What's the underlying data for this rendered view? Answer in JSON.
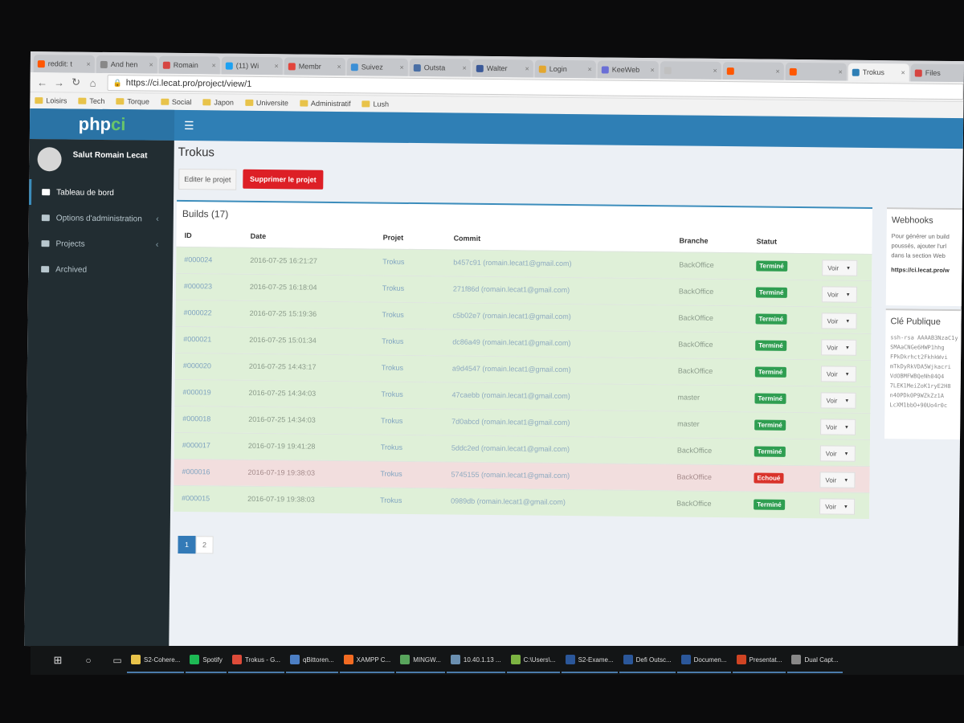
{
  "browser": {
    "tabs": [
      {
        "label": "reddit: t",
        "color": "#ff5700"
      },
      {
        "label": "And hen",
        "color": "#888888"
      },
      {
        "label": "Romain",
        "color": "#d64541"
      },
      {
        "label": "(11) Wi",
        "color": "#1da1f2"
      },
      {
        "label": "Membr",
        "color": "#e2453c"
      },
      {
        "label": "Suivez",
        "color": "#3b8fd6"
      },
      {
        "label": "Outsta",
        "color": "#4a6fa5"
      },
      {
        "label": "Walter",
        "color": "#3b5998"
      },
      {
        "label": "Login",
        "color": "#e3a72f"
      },
      {
        "label": "KeeWeb",
        "color": "#6a6fd6"
      },
      {
        "label": "",
        "color": "#c0c0c0"
      },
      {
        "label": "",
        "color": "#ff5700"
      },
      {
        "label": "",
        "color": "#ff5700"
      },
      {
        "label": "Trokus",
        "color": "#2f7fb5",
        "active": true
      },
      {
        "label": "Files",
        "color": "#d64541"
      }
    ],
    "url": "https://ci.lecat.pro/project/view/1",
    "bookmarks": [
      "Loisirs",
      "Tech",
      "Torque",
      "Social",
      "Japon",
      "Universite",
      "Administratif",
      "Lush"
    ]
  },
  "app": {
    "logo_main": "php",
    "logo_accent": "ci",
    "user_greeting": "Salut Romain Lecat",
    "sidebar": [
      {
        "label": "Tableau de bord",
        "active": true,
        "chevron": false
      },
      {
        "label": "Options d'administration",
        "active": false,
        "chevron": true
      },
      {
        "label": "Projects",
        "active": false,
        "chevron": true
      },
      {
        "label": "Archived",
        "active": false,
        "chevron": false
      }
    ],
    "page_title": "Trokus",
    "edit_button": "Editer le projet",
    "delete_button": "Supprimer le projet",
    "builds_title": "Builds (17)",
    "columns": {
      "id": "ID",
      "date": "Date",
      "project": "Projet",
      "commit": "Commit",
      "branch": "Branche",
      "status": "Statut"
    },
    "builds": [
      {
        "id": "#000024",
        "date": "2016-07-25 16:21:27",
        "project": "Trokus",
        "commit": "b457c91 (romain.lecat1@gmail.com)",
        "branch": "BackOffice",
        "status": "Terminé",
        "state": "ok"
      },
      {
        "id": "#000023",
        "date": "2016-07-25 16:18:04",
        "project": "Trokus",
        "commit": "271f86d (romain.lecat1@gmail.com)",
        "branch": "BackOffice",
        "status": "Terminé",
        "state": "ok"
      },
      {
        "id": "#000022",
        "date": "2016-07-25 15:19:36",
        "project": "Trokus",
        "commit": "c5b02e7 (romain.lecat1@gmail.com)",
        "branch": "BackOffice",
        "status": "Terminé",
        "state": "ok"
      },
      {
        "id": "#000021",
        "date": "2016-07-25 15:01:34",
        "project": "Trokus",
        "commit": "dc86a49 (romain.lecat1@gmail.com)",
        "branch": "BackOffice",
        "status": "Terminé",
        "state": "ok"
      },
      {
        "id": "#000020",
        "date": "2016-07-25 14:43:17",
        "project": "Trokus",
        "commit": "a9d4547 (romain.lecat1@gmail.com)",
        "branch": "BackOffice",
        "status": "Terminé",
        "state": "ok"
      },
      {
        "id": "#000019",
        "date": "2016-07-25 14:34:03",
        "project": "Trokus",
        "commit": "47caebb (romain.lecat1@gmail.com)",
        "branch": "master",
        "status": "Terminé",
        "state": "ok"
      },
      {
        "id": "#000018",
        "date": "2016-07-25 14:34:03",
        "project": "Trokus",
        "commit": "7d0abcd (romain.lecat1@gmail.com)",
        "branch": "master",
        "status": "Terminé",
        "state": "ok"
      },
      {
        "id": "#000017",
        "date": "2016-07-19 19:41:28",
        "project": "Trokus",
        "commit": "5ddc2ed (romain.lecat1@gmail.com)",
        "branch": "BackOffice",
        "status": "Terminé",
        "state": "ok"
      },
      {
        "id": "#000016",
        "date": "2016-07-19 19:38:03",
        "project": "Trokus",
        "commit": "5745155 (romain.lecat1@gmail.com)",
        "branch": "BackOffice",
        "status": "Echoué",
        "state": "fail"
      },
      {
        "id": "#000015",
        "date": "2016-07-19 19:38:03",
        "project": "Trokus",
        "commit": "0989db (romain.lecat1@gmail.com)",
        "branch": "BackOffice",
        "status": "Terminé",
        "state": "ok"
      }
    ],
    "view_button": "Voir",
    "pages": [
      "1",
      "2"
    ],
    "active_page": "1",
    "webhooks": {
      "title": "Webhooks",
      "lines": [
        "Pour générer un build",
        "poussés, ajouter l'url",
        "dans la section Web"
      ],
      "url": "https://ci.lecat.pro/w"
    },
    "public_key": {
      "title": "Clé Publique",
      "lines": [
        "ssh-rsa AAAAB3NzaC1y",
        "SMAaCNGe6HWP1hhg",
        "FPkDkrhct2FkhkWvi",
        "mTkDyRkVDA5Wjkacri",
        "VdOBMFWBQeNh04Q4",
        "7LEK1MeiZoK1ryE2H8",
        "n40PDk0P9WZkZz1A",
        "LcXM1bbO+90Uo4r0c"
      ]
    }
  },
  "taskbar": [
    {
      "label": "S2-Cohere...",
      "color": "#e8c34a"
    },
    {
      "label": "Spotify",
      "color": "#1db954"
    },
    {
      "label": "Trokus - G...",
      "color": "#dd4b39"
    },
    {
      "label": "qBittoren...",
      "color": "#4c7fc4"
    },
    {
      "label": "XAMPP C...",
      "color": "#f26b22"
    },
    {
      "label": "MINGW...",
      "color": "#58a55c"
    },
    {
      "label": "10.40.1.13 ...",
      "color": "#6a8fb0"
    },
    {
      "label": "C:\\Users\\...",
      "color": "#7cb342"
    },
    {
      "label": "S2-Exame...",
      "color": "#2b579a"
    },
    {
      "label": "Defi Outsc...",
      "color": "#2b579a"
    },
    {
      "label": "Documen...",
      "color": "#2b579a"
    },
    {
      "label": "Presentat...",
      "color": "#d04423"
    },
    {
      "label": "Dual Capt...",
      "color": "#888888"
    }
  ]
}
